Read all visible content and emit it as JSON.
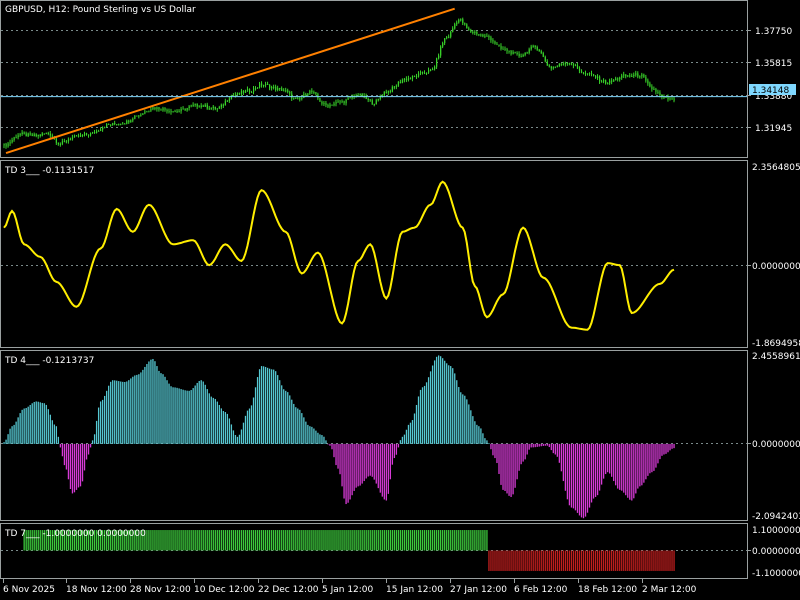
{
  "window": {
    "title": "GBPUSD, H12:  Pound Sterling vs US Dollar",
    "background": "#000000",
    "grid_color": "#7a8a8a",
    "axis_color": "#9aa0a0"
  },
  "price_panel": {
    "ticks": [
      "1.37750",
      "1.35815",
      "1.33880",
      "1.31945"
    ],
    "current_price_label": "1.34148",
    "current_price_color": "#7fd8ff",
    "candle_color": "#39d42a",
    "trendline_color": "#ff8000"
  },
  "td3": {
    "header": "TD 3___ -0.1131517",
    "ticks": [
      "2.3564805",
      "0.0000000",
      "-1.8694958"
    ],
    "line_color": "#ffee00"
  },
  "td4": {
    "header": "TD 4___ -0.1213737",
    "ticks": [
      "2.4558961",
      "0.0000000",
      "-2.0942403"
    ],
    "positive_color": "#56c8d2",
    "negative_color": "#d63bd6"
  },
  "td7": {
    "header": "TD 7___ -1.0000000 0.0000000",
    "ticks": [
      "1.1000000",
      "0.0000000",
      "-1.1000000"
    ],
    "positive_color": "#3cc83c",
    "negative_color": "#c01e1e"
  },
  "time_axis": {
    "labels": [
      "6 Nov 2025",
      "18 Nov 12:00",
      "28 Nov 12:00",
      "10 Dec 12:00",
      "22 Dec 12:00",
      "5 Jan 12:00",
      "15 Jan 12:00",
      "27 Jan 12:00",
      "6 Feb 12:00",
      "18 Feb 12:00",
      "2 Mar 12:00"
    ]
  },
  "chart_data": [
    {
      "type": "candlestick",
      "title": "GBPUSD, H12:  Pound Sterling vs US Dollar",
      "x_labels": [
        "6 Nov 2025",
        "18 Nov 12:00",
        "28 Nov 12:00",
        "10 Dec 12:00",
        "22 Dec 12:00",
        "5 Jan 12:00",
        "15 Jan 12:00",
        "27 Jan 12:00",
        "6 Feb 12:00",
        "18 Feb 12:00",
        "2 Mar 12:00"
      ],
      "ylim": [
        1.3062,
        1.3974
      ],
      "y_ticks": [
        1.3775,
        1.35815,
        1.3388,
        1.31945
      ],
      "current_price": 1.34148,
      "close_path": [
        [
          0,
          1.313
        ],
        [
          8,
          1.3195
        ],
        [
          15,
          1.3185
        ],
        [
          22,
          1.32
        ],
        [
          28,
          1.314
        ],
        [
          34,
          1.3175
        ],
        [
          42,
          1.3195
        ],
        [
          52,
          1.325
        ],
        [
          60,
          1.3265
        ],
        [
          66,
          1.3305
        ],
        [
          74,
          1.335
        ],
        [
          86,
          1.333
        ],
        [
          96,
          1.3365
        ],
        [
          106,
          1.3345
        ],
        [
          114,
          1.3425
        ],
        [
          122,
          1.345
        ],
        [
          128,
          1.3485
        ],
        [
          138,
          1.3455
        ],
        [
          146,
          1.3395
        ],
        [
          152,
          1.3445
        ],
        [
          160,
          1.3365
        ],
        [
          168,
          1.3385
        ],
        [
          176,
          1.3425
        ],
        [
          184,
          1.338
        ],
        [
          190,
          1.3445
        ],
        [
          200,
          1.352
        ],
        [
          212,
          1.3565
        ],
        [
          220,
          1.3762
        ],
        [
          226,
          1.3865
        ],
        [
          232,
          1.3795
        ],
        [
          240,
          1.3765
        ],
        [
          248,
          1.369
        ],
        [
          256,
          1.3655
        ],
        [
          264,
          1.3705
        ],
        [
          272,
          1.3585
        ],
        [
          280,
          1.3615
        ],
        [
          290,
          1.3545
        ],
        [
          300,
          1.3498
        ],
        [
          308,
          1.3535
        ],
        [
          316,
          1.3542
        ],
        [
          322,
          1.3462
        ],
        [
          328,
          1.3405
        ],
        [
          333,
          1.3395
        ]
      ],
      "trendline": {
        "from": [
          1,
          1.3085
        ],
        "to": [
          224,
          1.3929
        ]
      }
    },
    {
      "type": "line",
      "name": "TD 3",
      "current_value": -0.1131517,
      "ylim": [
        -1.8694958,
        2.3564805
      ],
      "path": [
        [
          0,
          0.9
        ],
        [
          4,
          1.3
        ],
        [
          10,
          0.5
        ],
        [
          18,
          0.2
        ],
        [
          26,
          -0.4
        ],
        [
          36,
          -1.0
        ],
        [
          48,
          0.4
        ],
        [
          56,
          1.35
        ],
        [
          64,
          0.8
        ],
        [
          72,
          1.45
        ],
        [
          84,
          0.5
        ],
        [
          94,
          0.6
        ],
        [
          102,
          0.0
        ],
        [
          110,
          0.5
        ],
        [
          118,
          0.1
        ],
        [
          128,
          1.8
        ],
        [
          140,
          0.8
        ],
        [
          148,
          -0.2
        ],
        [
          156,
          0.3
        ],
        [
          168,
          -1.4
        ],
        [
          176,
          0.1
        ],
        [
          182,
          0.5
        ],
        [
          190,
          -0.8
        ],
        [
          198,
          0.8
        ],
        [
          204,
          0.9
        ],
        [
          212,
          1.45
        ],
        [
          218,
          2.0
        ],
        [
          228,
          0.9
        ],
        [
          234,
          -0.5
        ],
        [
          240,
          -1.25
        ],
        [
          248,
          -0.7
        ],
        [
          258,
          0.9
        ],
        [
          268,
          -0.3
        ],
        [
          282,
          -1.5
        ],
        [
          290,
          -1.55
        ],
        [
          300,
          0.05
        ],
        [
          306,
          0.0
        ],
        [
          312,
          -1.15
        ],
        [
          326,
          -0.45
        ],
        [
          333,
          -0.11
        ]
      ]
    },
    {
      "type": "bar",
      "name": "TD 4",
      "current_value": -0.1213737,
      "ylim": [
        -2.0942403,
        2.4558961
      ],
      "positive_color": "#56c8d2",
      "negative_color": "#d63bd6",
      "path": [
        [
          0,
          0.05
        ],
        [
          4,
          0.5
        ],
        [
          10,
          1.0
        ],
        [
          16,
          1.2
        ],
        [
          20,
          1.15
        ],
        [
          26,
          0.5
        ],
        [
          28,
          -0.1
        ],
        [
          30,
          -0.6
        ],
        [
          34,
          -1.4
        ],
        [
          38,
          -1.2
        ],
        [
          42,
          -0.3
        ],
        [
          44,
          0.1
        ],
        [
          48,
          1.2
        ],
        [
          54,
          1.8
        ],
        [
          60,
          1.75
        ],
        [
          66,
          1.95
        ],
        [
          74,
          2.4
        ],
        [
          78,
          2.0
        ],
        [
          84,
          1.6
        ],
        [
          92,
          1.5
        ],
        [
          98,
          1.8
        ],
        [
          104,
          1.3
        ],
        [
          110,
          0.9
        ],
        [
          116,
          0.2
        ],
        [
          122,
          1.0
        ],
        [
          128,
          2.2
        ],
        [
          134,
          2.1
        ],
        [
          140,
          1.5
        ],
        [
          146,
          1.0
        ],
        [
          152,
          0.5
        ],
        [
          158,
          0.25
        ],
        [
          162,
          -0.05
        ],
        [
          166,
          -0.7
        ],
        [
          170,
          -1.7
        ],
        [
          176,
          -1.2
        ],
        [
          182,
          -0.9
        ],
        [
          190,
          -1.6
        ],
        [
          194,
          -0.4
        ],
        [
          198,
          0.2
        ],
        [
          202,
          0.6
        ],
        [
          208,
          1.6
        ],
        [
          216,
          2.5
        ],
        [
          222,
          2.2
        ],
        [
          228,
          1.4
        ],
        [
          236,
          0.5
        ],
        [
          240,
          0.1
        ],
        [
          244,
          -0.4
        ],
        [
          248,
          -1.3
        ],
        [
          252,
          -1.5
        ],
        [
          258,
          -0.5
        ],
        [
          262,
          -0.1
        ],
        [
          270,
          -0.05
        ],
        [
          274,
          -0.3
        ],
        [
          282,
          -1.8
        ],
        [
          288,
          -2.1
        ],
        [
          294,
          -1.5
        ],
        [
          300,
          -0.8
        ],
        [
          306,
          -1.3
        ],
        [
          312,
          -1.6
        ],
        [
          316,
          -1.2
        ],
        [
          322,
          -0.8
        ],
        [
          328,
          -0.3
        ],
        [
          333,
          -0.12
        ]
      ]
    },
    {
      "type": "bar",
      "name": "TD 7",
      "values_text": "-1.0000000 0.0000000",
      "ylim": [
        -1.1,
        1.1
      ],
      "segments": [
        {
          "from": 10,
          "to": 240,
          "value": 1.0
        },
        {
          "from": 241,
          "to": 333,
          "value": -1.0
        }
      ]
    }
  ]
}
